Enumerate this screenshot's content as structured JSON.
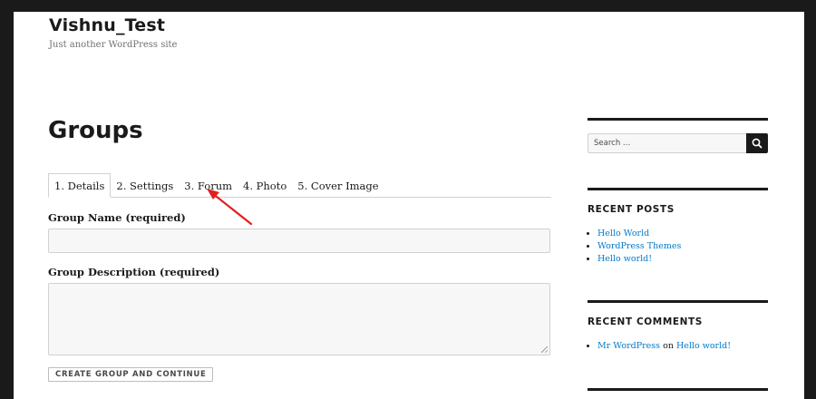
{
  "site": {
    "title": "Vishnu_Test",
    "tagline": "Just another WordPress site"
  },
  "main": {
    "page_title": "Groups",
    "tabs": [
      {
        "label": "1. Details",
        "active": true
      },
      {
        "label": "2. Settings",
        "active": false
      },
      {
        "label": "3. Forum",
        "active": false
      },
      {
        "label": "4. Photo",
        "active": false
      },
      {
        "label": "5. Cover Image",
        "active": false
      }
    ],
    "group_name_label": "Group Name (required)",
    "group_name_value": "",
    "group_description_label": "Group Description (required)",
    "group_description_value": "",
    "submit_label": "Create Group and Continue"
  },
  "sidebar": {
    "search_placeholder": "Search …",
    "recent_posts_title": "Recent Posts",
    "recent_posts": [
      "Hello World",
      "WordPress Themes",
      "Hello world!"
    ],
    "recent_comments_title": "Recent Comments",
    "recent_comment": {
      "author": "Mr WordPress",
      "connector": "on",
      "post": "Hello world!"
    }
  },
  "colors": {
    "accent": "#007acc",
    "annotation_arrow": "#e02020",
    "frame": "#1a1a1a"
  },
  "icons": {
    "search": "search-icon",
    "annotation": "arrow-annotation-icon"
  }
}
